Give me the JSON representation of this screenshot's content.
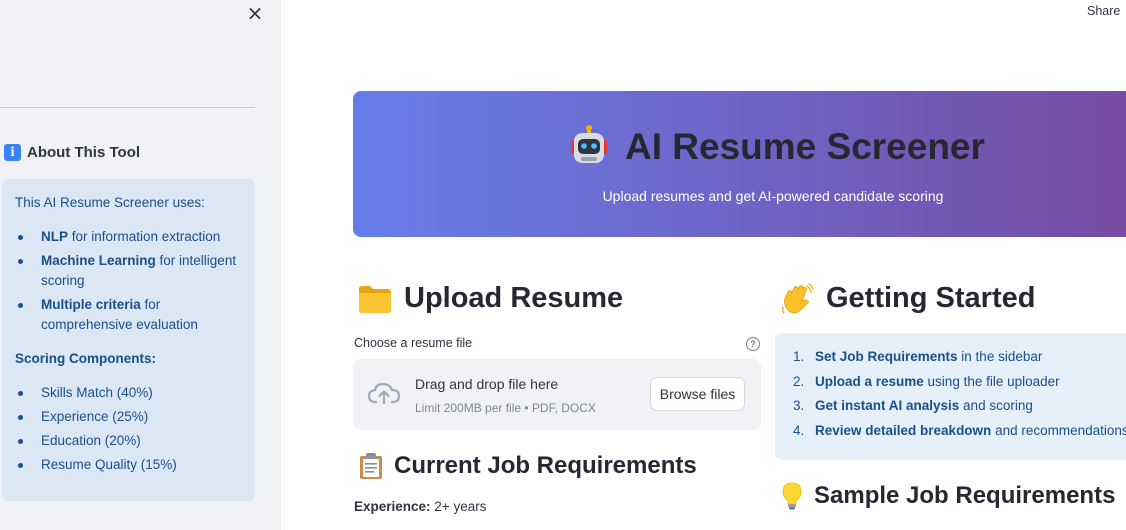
{
  "header": {
    "share_label": "Share",
    "close_icon": "×"
  },
  "sidebar": {
    "about_title": "About This Tool",
    "intro": "This AI Resume Screener uses:",
    "features": [
      {
        "bold": "NLP",
        "rest": " for information extraction"
      },
      {
        "bold": "Machine Learning",
        "rest": " for intelligent scoring"
      },
      {
        "bold": "Multiple criteria",
        "rest": " for comprehensive evaluation"
      }
    ],
    "scoring_title": "Scoring Components:",
    "scoring": [
      "Skills Match (40%)",
      "Experience (25%)",
      "Education (20%)",
      "Resume Quality (15%)"
    ]
  },
  "banner": {
    "title": "AI Resume Screener",
    "subtitle": "Upload resumes and get AI-powered candidate scoring"
  },
  "upload": {
    "title": "Upload Resume",
    "label": "Choose a resume file",
    "help_icon": "?",
    "drop_text": "Drag and drop file here",
    "limit_text": "Limit 200MB per file • PDF, DOCX",
    "browse_label": "Browse files"
  },
  "job_requirements": {
    "title": "Current Job Requirements",
    "experience_label": "Experience:",
    "experience_value": " 2+ years"
  },
  "getting_started": {
    "title": "Getting Started",
    "steps": [
      {
        "num": "1.",
        "bold": "Set Job Requirements",
        "rest": " in the sidebar"
      },
      {
        "num": "2.",
        "bold": "Upload a resume",
        "rest": " using the file uploader"
      },
      {
        "num": "3.",
        "bold": "Get instant AI analysis",
        "rest": " and scoring"
      },
      {
        "num": "4.",
        "bold": "Review detailed breakdown",
        "rest": " and recommendations"
      }
    ]
  },
  "sample_requirements": {
    "title": "Sample Job Requirements"
  },
  "colors": {
    "banner_start": "#667eea",
    "banner_end": "#764ba2",
    "info_bg": "#dbe7f4",
    "info_text": "#1b4f8a",
    "sidebar_bg": "#f0f2f6"
  }
}
